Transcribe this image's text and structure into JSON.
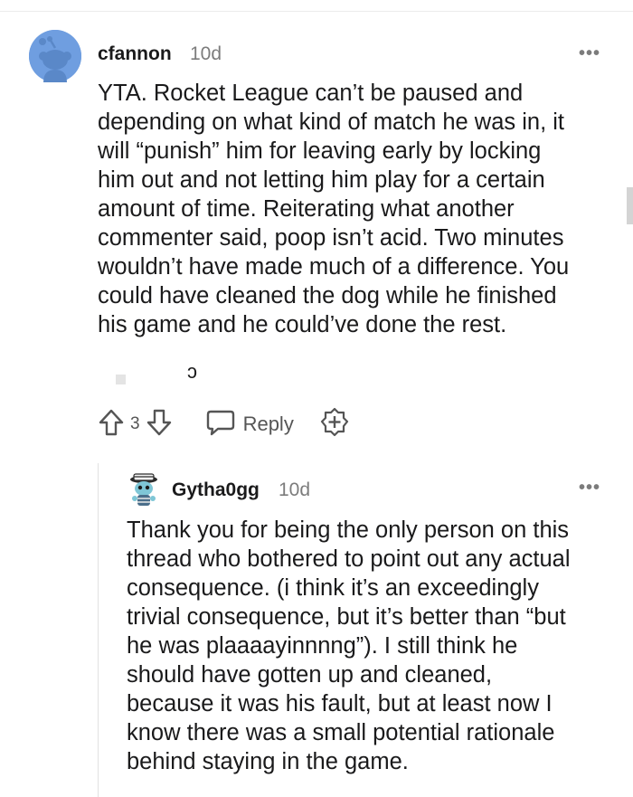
{
  "comment": {
    "author": "cfannon",
    "time": "10d",
    "more": "•••",
    "body": "YTA. Rocket League can’t be paused and\ndepending on what kind of match he was in, it\nwill “punish” him for leaving early by locking\nhim out and not letting him play for a certain\namount of time. Reiterating what another\ncommenter said, poop isn’t acid. Two minutes\nwouldn’t have made much of a difference. You\ncould have cleaned the dog while he finished\nhis game and he could’ve done the rest.",
    "stray_glyph": "ɔ",
    "vote_count": "3",
    "reply_label": "Reply"
  },
  "reply": {
    "author": "Gytha0gg",
    "time": "10d",
    "more": "•••",
    "body": "Thank you for being the only person on this\nthread who bothered to point out any actual\nconsequence. (i think it’s an exceedingly\ntrivial consequence, but it’s better than “but\nhe was plaaaayinnnng”). I still think he\nshould have gotten up and cleaned,\nbecause it was his fault, but at least now I\nknow there was a small potential rationale\nbehind staying in the game."
  },
  "colors": {
    "avatar_bg": "#6f9ee0",
    "text": "#1a1a1b",
    "muted": "#7c7c7c"
  },
  "icons": [
    "reddit-snoo-avatar-icon",
    "upvote-icon",
    "downvote-icon",
    "reply-bubble-icon",
    "award-plus-icon",
    "user-avatar-icon"
  ]
}
